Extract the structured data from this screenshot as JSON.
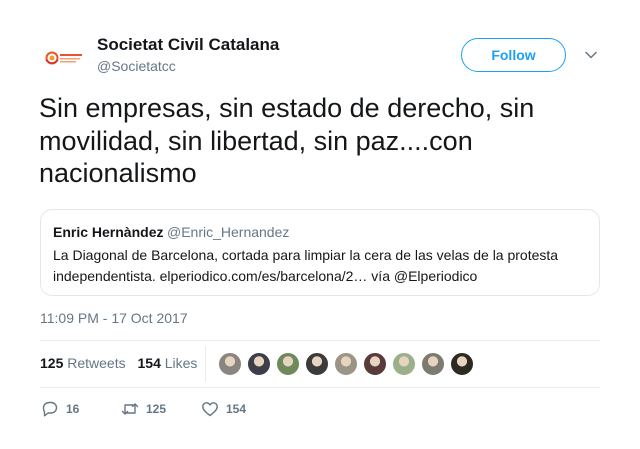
{
  "author": {
    "name": "Societat Civil Catalana",
    "handle": "@Societatcc",
    "avatar_icon": "societat-civil-catalana-logo",
    "brand_color": "#e8542b"
  },
  "follow_label": "Follow",
  "accent_color": "#1da1f2",
  "tweet_text": "Sin empresas, sin estado de derecho, sin\nmovilidad, sin libertad, sin paz....con\nnacionalismo",
  "quoted": {
    "name": "Enric Hernàndez",
    "handle": "@Enric_Hernandez",
    "text": "La Diagonal de Barcelona, cortada para limpiar la cera de las velas de la protesta independentista. elperiodico.com/es/barcelona/2… vía @Elperiodico"
  },
  "timestamp": "11:09 PM - 17 Oct 2017",
  "stats": {
    "retweets_count": "125",
    "retweets_label": "Retweets",
    "likes_count": "154",
    "likes_label": "Likes"
  },
  "liker_avatars": [
    {
      "color": "#8a8580"
    },
    {
      "color": "#3a3f4a"
    },
    {
      "color": "#6f8a5a"
    },
    {
      "color": "#3b3b3b"
    },
    {
      "color": "#9a9585"
    },
    {
      "color": "#5a3b3b"
    },
    {
      "color": "#9bb08a"
    },
    {
      "color": "#7d7a70"
    },
    {
      "color": "#2d2a22"
    }
  ],
  "actions": {
    "reply_count": "16",
    "retweet_count": "125",
    "like_count": "154"
  }
}
